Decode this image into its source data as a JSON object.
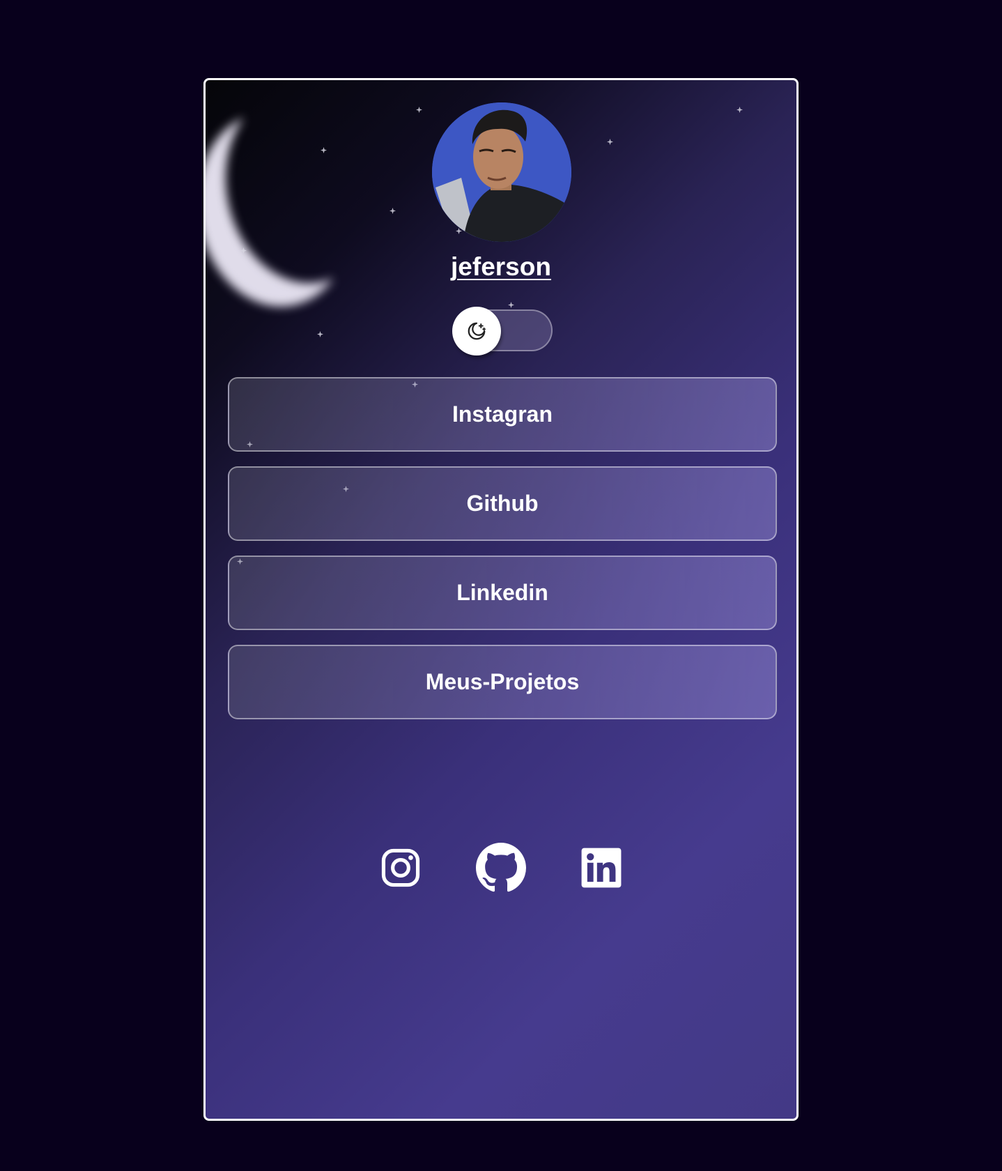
{
  "profile": {
    "name": "jeferson",
    "avatar_alt": "profile photo"
  },
  "theme_toggle": {
    "state": "dark",
    "icon": "moon-stars-icon"
  },
  "links": [
    {
      "label": "Instagran"
    },
    {
      "label": "Github"
    },
    {
      "label": "Linkedin"
    },
    {
      "label": "Meus-Projetos"
    }
  ],
  "socials": [
    {
      "icon": "instagram-icon"
    },
    {
      "icon": "github-icon"
    },
    {
      "icon": "linkedin-icon"
    }
  ],
  "colors": {
    "page_background": "#08001c",
    "card_border": "#ffffff",
    "gradient_dark": "#050509",
    "gradient_light": "#463b8e",
    "avatar_background": "#3d57c4",
    "text": "#ffffff"
  }
}
